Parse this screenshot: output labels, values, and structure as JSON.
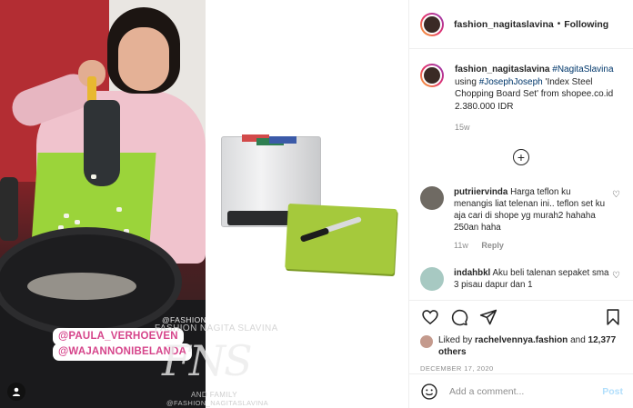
{
  "post_header": {
    "username": "fashion_nagitaslavina",
    "separator": "•",
    "follow_status": "Following"
  },
  "media": {
    "tag_1": "@PAULA_VERHOEVEN",
    "tag_2": "@WAJANNONIBELANDA",
    "watermark_top": "@FASHION_NAGITASLAVINA",
    "watermark_name": "FASHION NAGITA SLAVINA",
    "watermark_logo": "FNS",
    "watermark_family": "AND FAMILY",
    "watermark_bottom": "@FASHION_NAGITASLAVINA"
  },
  "caption": {
    "username": "fashion_nagitaslavina",
    "hashtag_1": "#NagitaSlavina",
    "word_using": "using",
    "hashtag_2": "#JosephJoseph",
    "text": "'Index Steel Chopping Board Set' from shopee.co.id 2.380.000 IDR",
    "age": "15w"
  },
  "load_more": "+",
  "comments": [
    {
      "username": "putriiervinda",
      "text": "Harga teflon ku menangis liat telenan ini.. teflon set ku aja cari di shope yg murah2 hahaha 250an haha",
      "age": "11w",
      "reply_label": "Reply"
    },
    {
      "username": "indahbkl",
      "text": "Aku beli talenan sepaket sma 3 pisau dapur dan 1"
    }
  ],
  "likes": {
    "prefix": "Liked by",
    "user": "rachelvennya.fashion",
    "and": "and",
    "count": "12,377 others"
  },
  "post_date": "DECEMBER 17, 2020",
  "add_comment": {
    "placeholder": "Add a comment...",
    "post_label": "Post"
  },
  "colors": {
    "link": "#00376b",
    "tag_text": "#d6458b",
    "post_disabled": "#b2dffc"
  }
}
